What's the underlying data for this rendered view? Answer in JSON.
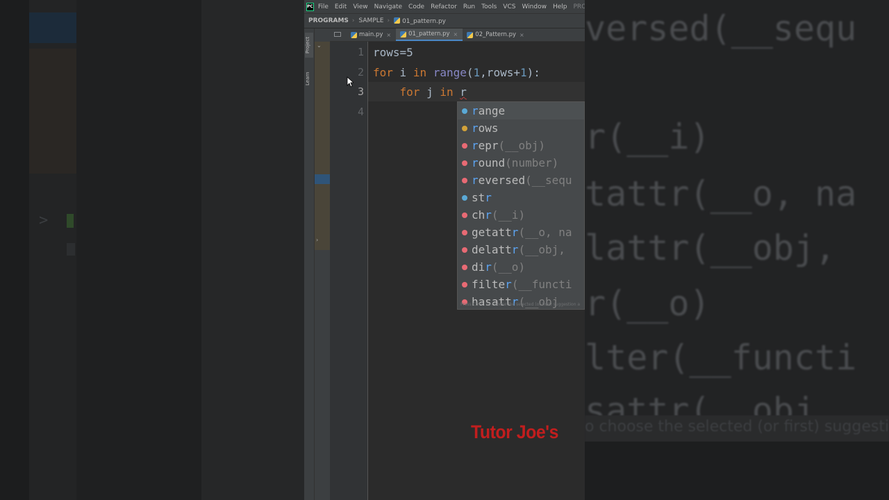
{
  "menubar": {
    "app_icon": "pycharm-logo",
    "app_logo_text": "PC",
    "items": [
      "File",
      "Edit",
      "View",
      "Navigate",
      "Code",
      "Refactor",
      "Run",
      "Tools",
      "VCS",
      "Window",
      "Help"
    ],
    "project_label": "PROGRAMS"
  },
  "breadcrumb": {
    "root": "PROGRAMS",
    "folder": "SAMPLE",
    "file": "01_pattern.py"
  },
  "toolwindows": {
    "project": "Project",
    "learn": "Learn"
  },
  "tabs": [
    {
      "label": "main.py",
      "active": false
    },
    {
      "label": "01_pattern.py",
      "active": true
    },
    {
      "label": "02_Pattern.py",
      "active": false
    }
  ],
  "editor": {
    "line_numbers": [
      "1",
      "2",
      "3",
      "4"
    ],
    "current_line": 3,
    "lines": {
      "l1_text": "rows=5",
      "l2_for": "for",
      "l2_i": " i ",
      "l2_in": "in",
      "l2_range": "range",
      "l2_paren_open": "(",
      "l2_one": "1",
      "l2_rest": ",rows+",
      "l2_one_b": "1",
      "l2_end": "):",
      "l3_indent": "    ",
      "l3_for": "for",
      "l3_j": " j ",
      "l3_in": "in",
      "l3_space": " ",
      "l3_typed": "r"
    }
  },
  "completion": {
    "items": [
      {
        "kind": "class",
        "match": "r",
        "name": "ange",
        "sig": ""
      },
      {
        "kind": "variable",
        "match": "r",
        "name": "ows",
        "sig": ""
      },
      {
        "kind": "function",
        "match": "r",
        "name": "epr",
        "sig": "(__obj)"
      },
      {
        "kind": "function",
        "match": "r",
        "name": "ound",
        "sig": "(number)"
      },
      {
        "kind": "class",
        "match": "r",
        "name": "eversed",
        "sig": "(__sequ"
      },
      {
        "kind": "class",
        "match": "st",
        "name": "r",
        "sig": ""
      },
      {
        "kind": "function",
        "match": "ch",
        "name": "r",
        "sig": "(__i)"
      },
      {
        "kind": "function",
        "match": "getatt",
        "name": "r",
        "sig": "(__o, na"
      },
      {
        "kind": "function",
        "match": "delatt",
        "name": "r",
        "sig": "(__obj,"
      },
      {
        "kind": "function",
        "match": "di",
        "name": "r",
        "sig": "(__o)"
      },
      {
        "kind": "class",
        "match": "filte",
        "name": "r",
        "sig": "(__functi"
      },
      {
        "kind": "function",
        "match": "hasatt",
        "name": "r",
        "sig": "(__obj"
      }
    ],
    "footer": "Press Ctrl+. to choose the selected (or first) suggestion a"
  },
  "background_right": {
    "lines": [
      "versed(__sequ",
      "",
      "r(__i)",
      "tattr(__o, na",
      "lattr(__obj,",
      "r(__o)",
      "lter(__functi",
      "sattr(__obj"
    ],
    "tip": "o choose the selected (or first) suggestion a"
  },
  "watermark": "Tutor Joe's",
  "colors": {
    "keyword": "#cc7832",
    "builtin": "#8888c6",
    "number": "#6897bb",
    "text": "#a9b7c6",
    "match": "#5ca3f0",
    "watermark": "#c21e1e"
  }
}
